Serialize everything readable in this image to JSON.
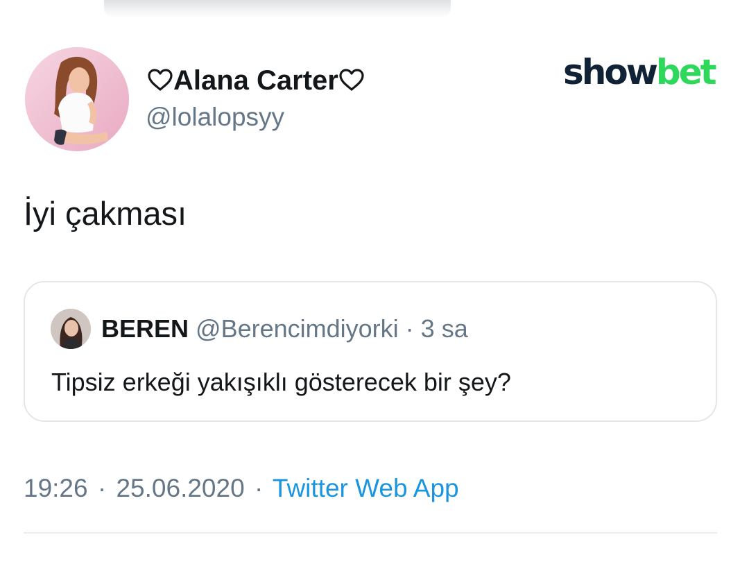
{
  "tweet": {
    "author": {
      "display_name": "Alana Carter",
      "name_decoration_icon": "heart-outline-icon",
      "handle": "@lolalopsyy",
      "avatar_icon": "profile-photo"
    },
    "text": "İyi çakması",
    "quoted_tweet": {
      "author_name": "BEREN",
      "author_handle": "@Berencimdiyorki",
      "separator": "·",
      "time_ago": "3 sa",
      "text": "Tipsiz erkeği yakışıklı gösterecek bir şey?",
      "avatar_icon": "profile-photo"
    },
    "timestamp": {
      "time": "19:26",
      "separator_1": "·",
      "date": "25.06.2020",
      "separator_2": "·",
      "source": "Twitter Web App"
    }
  },
  "watermark": {
    "part_1": "show",
    "part_2": "bet",
    "colors": {
      "part_1": "#0f2236",
      "part_2": "#2ed85a"
    }
  },
  "colors": {
    "primary_text": "#14171a",
    "secondary_text": "#657786",
    "link": "#1b95e0",
    "border": "#e3e7ea"
  }
}
